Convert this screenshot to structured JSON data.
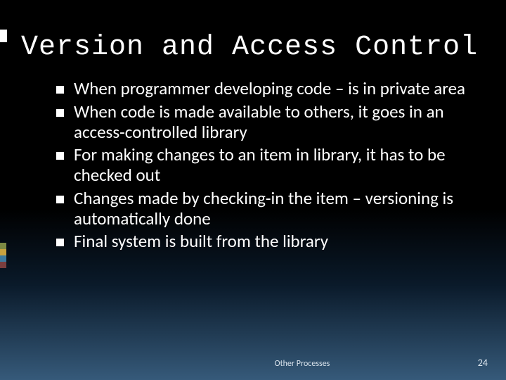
{
  "title": "Version and Access Control",
  "bullets": [
    "When programmer developing code – is in private area",
    "When code is made available to others, it goes in an access-controlled library",
    "For making changes to an item in library, it has to be checked out",
    "Changes made by checking-in the item – versioning is automatically done",
    "Final system is built from the library"
  ],
  "footer": {
    "label": "Other Processes",
    "page": "24"
  },
  "colors": {
    "accent": "#ffffff",
    "bg_top": "#000000",
    "bg_bottom": "#365a7a"
  }
}
